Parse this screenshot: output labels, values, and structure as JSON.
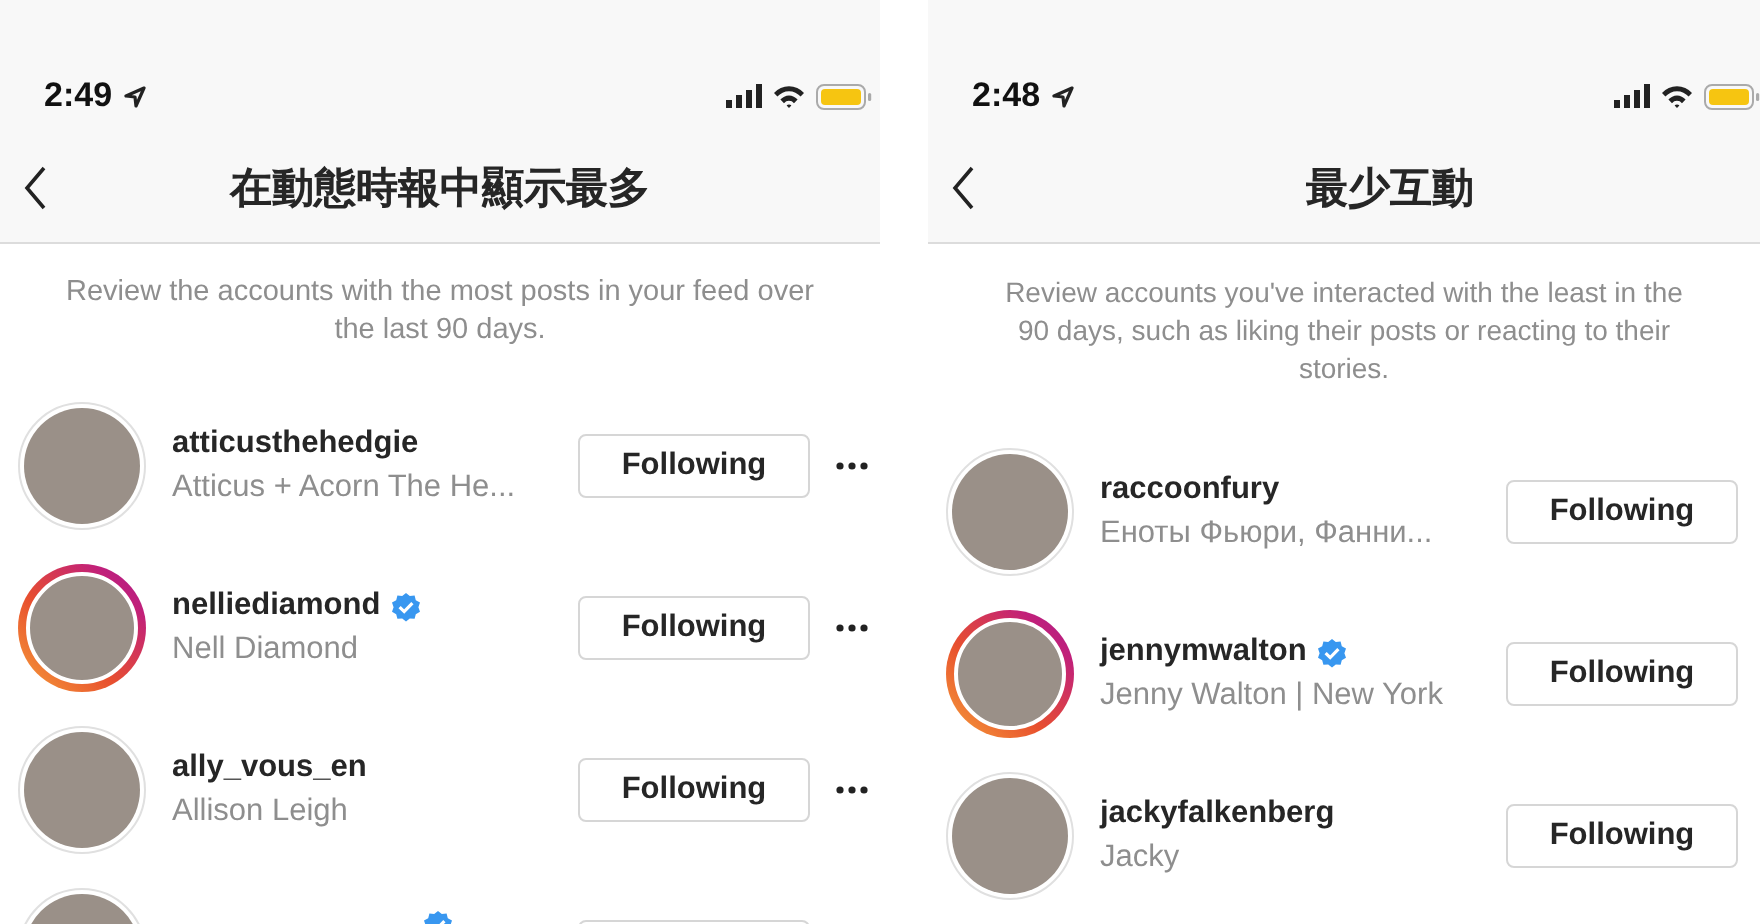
{
  "screens": [
    {
      "status_bar": {
        "time": "2:49"
      },
      "title": "在動態時報中顯示最多",
      "description_lines": [
        "Review the accounts with the most posts in your feed over",
        "the last 90 days."
      ],
      "accounts": [
        {
          "username": "atticusthehedgie",
          "name": "Atticus + Acorn The He...",
          "verified": false,
          "story_ring": false,
          "button": "Following",
          "more_menu": true
        },
        {
          "username": "nelliediamond",
          "name": "Nell Diamond",
          "verified": true,
          "story_ring": true,
          "button": "Following",
          "more_menu": true
        },
        {
          "username": "ally_vous_en",
          "name": "Allison Leigh",
          "verified": false,
          "story_ring": false,
          "button": "Following",
          "more_menu": true
        },
        {
          "verified": true,
          "story_ring": false,
          "more_menu": false
        }
      ]
    },
    {
      "status_bar": {
        "time": "2:48"
      },
      "title": "最少互動",
      "description_lines": [
        "Review accounts you've interacted with the least in the",
        "90 days, such as liking their posts or reacting to their",
        "stories."
      ],
      "accounts": [
        {
          "username": "raccoonfury",
          "name": "Еноты Фьюри, Фанни...",
          "verified": false,
          "story_ring": false,
          "button": "Following",
          "more_menu": false
        },
        {
          "username": "jennymwalton",
          "name": "Jenny Walton | New York",
          "verified": true,
          "story_ring": true,
          "button": "Following",
          "more_menu": false
        },
        {
          "username": "jackyfalkenberg",
          "name": "Jacky",
          "verified": false,
          "story_ring": false,
          "button": "Following",
          "more_menu": false
        }
      ]
    }
  ]
}
